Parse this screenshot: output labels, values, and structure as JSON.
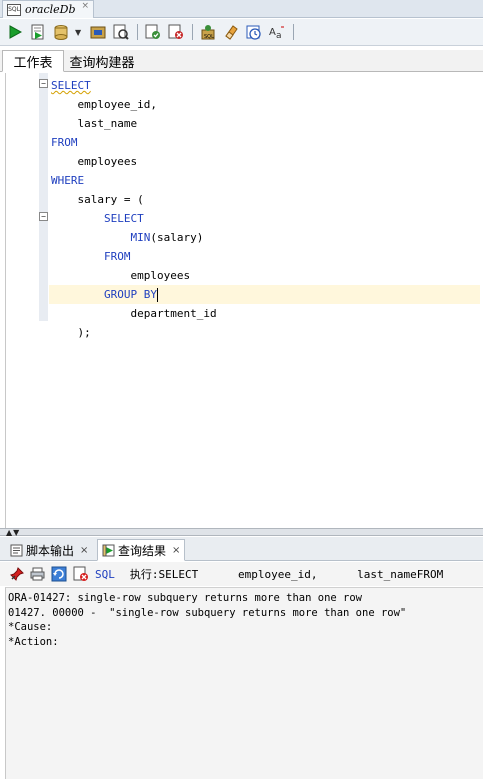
{
  "document_tab": {
    "label": "oracleDb",
    "close": "×",
    "icon_text": "SQL"
  },
  "toolbar": {
    "buttons": [
      "run-statement-icon",
      "run-script-icon",
      "commit-icon",
      "rollback-icon",
      "autotrace-icon",
      "explain-plan-icon",
      "sql-tuning-icon",
      "clear-icon",
      "history-icon",
      "format-icon"
    ]
  },
  "worksheet_tabs": [
    {
      "label": "工作表",
      "active": true
    },
    {
      "label": "查询构建器",
      "active": false
    }
  ],
  "editor": {
    "lines": [
      {
        "indent": "",
        "keyword": "SELECT",
        "text": ""
      },
      {
        "indent": "    ",
        "keyword": "",
        "text": "employee_id,"
      },
      {
        "indent": "    ",
        "keyword": "",
        "text": "last_name"
      },
      {
        "indent": "",
        "keyword": "FROM",
        "text": ""
      },
      {
        "indent": "    ",
        "keyword": "",
        "text": "employees"
      },
      {
        "indent": "",
        "keyword": "WHERE",
        "text": ""
      },
      {
        "indent": "    ",
        "keyword": "",
        "text": "salary = ("
      },
      {
        "indent": "        ",
        "keyword": "SELECT",
        "text": ""
      },
      {
        "indent": "            ",
        "keyword": "MIN",
        "text": "(salary)"
      },
      {
        "indent": "        ",
        "keyword": "FROM",
        "text": ""
      },
      {
        "indent": "            ",
        "keyword": "",
        "text": "employees"
      },
      {
        "indent": "        ",
        "keyword": "GROUP BY",
        "text": ""
      },
      {
        "indent": "            ",
        "keyword": "",
        "text": "department_id"
      },
      {
        "indent": "    ",
        "keyword": "",
        "text": ");"
      }
    ],
    "fold_marker": "−"
  },
  "output_tabs": [
    {
      "label": "脚本输出",
      "close": "×"
    },
    {
      "label": "查询结果",
      "close": "×"
    }
  ],
  "results_toolbar": {
    "sql_label": "SQL",
    "exec_label": "执行:SELECT      employee_id,      last_nameFROM      employees\\"
  },
  "results": {
    "lines": [
      "ORA-01427: single-row subquery returns more than one row",
      "01427. 00000 -  \"single-row subquery returns more than one row\"",
      "*Cause:",
      "*Action:"
    ]
  },
  "colors": {
    "keyword": "#1f3fbf",
    "current_line": "#fff7dc",
    "gutter": "#e8ecf2"
  }
}
